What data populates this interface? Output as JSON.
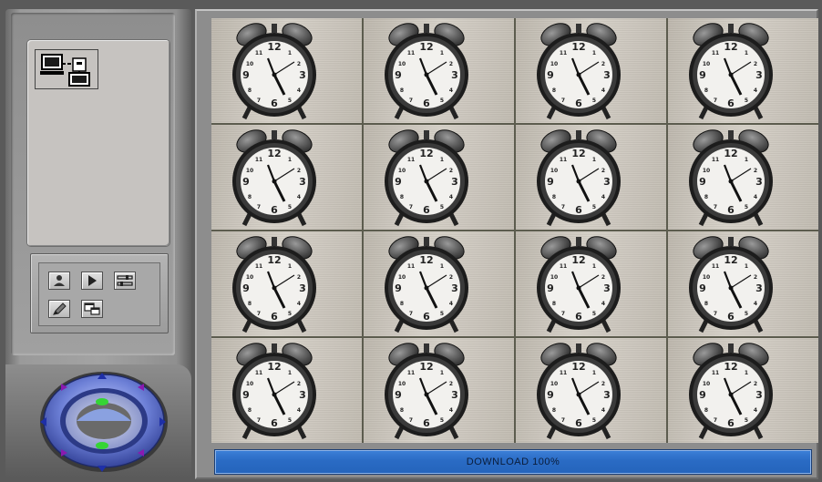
{
  "download": {
    "label": "DOWNLOAD",
    "percent_text": "100%",
    "progress": 1.0
  },
  "toolbar": {
    "info_icon": "network-computer-icon",
    "buttons": [
      {
        "icon": "user-icon"
      },
      {
        "icon": "play-icon"
      },
      {
        "icon": "settings-sliders-icon"
      },
      {
        "icon": "pencil-icon"
      },
      {
        "icon": "window-layout-icon"
      }
    ]
  },
  "ptz": {
    "arrows": [
      "up",
      "up-right",
      "right",
      "down-right",
      "down",
      "down-left",
      "left",
      "up-left"
    ],
    "center_buttons": [
      "zoom-in",
      "zoom-out"
    ]
  },
  "cameras": {
    "count": 16,
    "subject": "alarm-clock"
  },
  "colors": {
    "progress": "#2a6bc4",
    "ptz_ring": "#5c6fc0",
    "ptz_led": "#3adc3a"
  }
}
